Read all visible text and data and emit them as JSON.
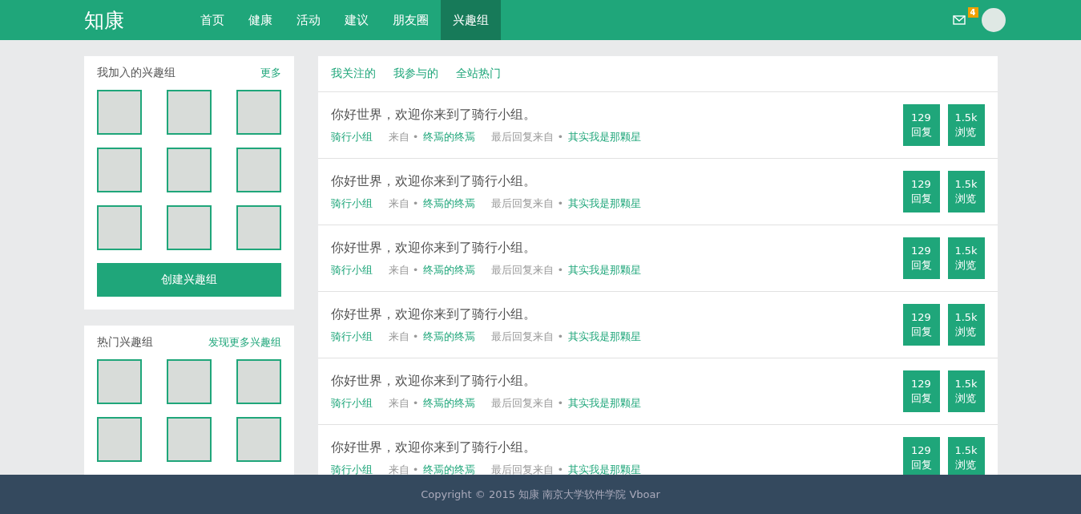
{
  "header": {
    "logo": "知康",
    "nav": [
      {
        "label": "首页",
        "selected": false
      },
      {
        "label": "健康",
        "selected": false
      },
      {
        "label": "活动",
        "selected": false
      },
      {
        "label": "建议",
        "selected": false
      },
      {
        "label": "朋友圈",
        "selected": false
      },
      {
        "label": "兴趣组",
        "selected": true
      }
    ],
    "mail_badge": "4"
  },
  "sidebar": [
    {
      "title": "我加入的兴趣组",
      "link": "更多",
      "groups": [
        {
          "kind": "photo"
        },
        {
          "kind": "photo"
        },
        {
          "kind": "photo"
        },
        {
          "kind": "photo"
        },
        {
          "kind": "photo"
        },
        {
          "kind": "photo"
        },
        {
          "kind": "photo"
        },
        {
          "kind": "photo"
        },
        {
          "kind": "photo"
        }
      ],
      "button": "创建兴趣组"
    },
    {
      "title": "热门兴趣组",
      "link": "发现更多兴趣组",
      "groups": [
        {
          "kind": "photo"
        },
        {
          "kind": "photo"
        },
        {
          "kind": "photo"
        },
        {
          "kind": "photo"
        },
        {
          "kind": "photo"
        },
        {
          "kind": "photo"
        }
      ]
    }
  ],
  "tabs": [
    "我关注的",
    "我参与的",
    "全站热门"
  ],
  "posts": [
    {
      "title": "你好世界，欢迎你来到了骑行小组。",
      "group": "骑行小组",
      "from_label": "来自 •",
      "author": "终焉的终焉",
      "last_label": "最后回复来自 •",
      "last_user": "其实我是那颗星",
      "replies": "129",
      "replies_label": "回复",
      "views": "1.5k",
      "views_label": "浏览"
    },
    {
      "title": "你好世界，欢迎你来到了骑行小组。",
      "group": "骑行小组",
      "from_label": "来自 •",
      "author": "终焉的终焉",
      "last_label": "最后回复来自 •",
      "last_user": "其实我是那颗星",
      "replies": "129",
      "replies_label": "回复",
      "views": "1.5k",
      "views_label": "浏览"
    },
    {
      "title": "你好世界，欢迎你来到了骑行小组。",
      "group": "骑行小组",
      "from_label": "来自 •",
      "author": "终焉的终焉",
      "last_label": "最后回复来自 •",
      "last_user": "其实我是那颗星",
      "replies": "129",
      "replies_label": "回复",
      "views": "1.5k",
      "views_label": "浏览"
    },
    {
      "title": "你好世界，欢迎你来到了骑行小组。",
      "group": "骑行小组",
      "from_label": "来自 •",
      "author": "终焉的终焉",
      "last_label": "最后回复来自 •",
      "last_user": "其实我是那颗星",
      "replies": "129",
      "replies_label": "回复",
      "views": "1.5k",
      "views_label": "浏览"
    },
    {
      "title": "你好世界，欢迎你来到了骑行小组。",
      "group": "骑行小组",
      "from_label": "来自 •",
      "author": "终焉的终焉",
      "last_label": "最后回复来自 •",
      "last_user": "其实我是那颗星",
      "replies": "129",
      "replies_label": "回复",
      "views": "1.5k",
      "views_label": "浏览"
    },
    {
      "title": "你好世界，欢迎你来到了骑行小组。",
      "group": "骑行小组",
      "from_label": "来自 •",
      "author": "终焉的终焉",
      "last_label": "最后回复来自 •",
      "last_user": "其实我是那颗星",
      "replies": "129",
      "replies_label": "回复",
      "views": "1.5k",
      "views_label": "浏览"
    }
  ],
  "footer": "Copyright © 2015 知康 南京大学软件学院 Vboar"
}
